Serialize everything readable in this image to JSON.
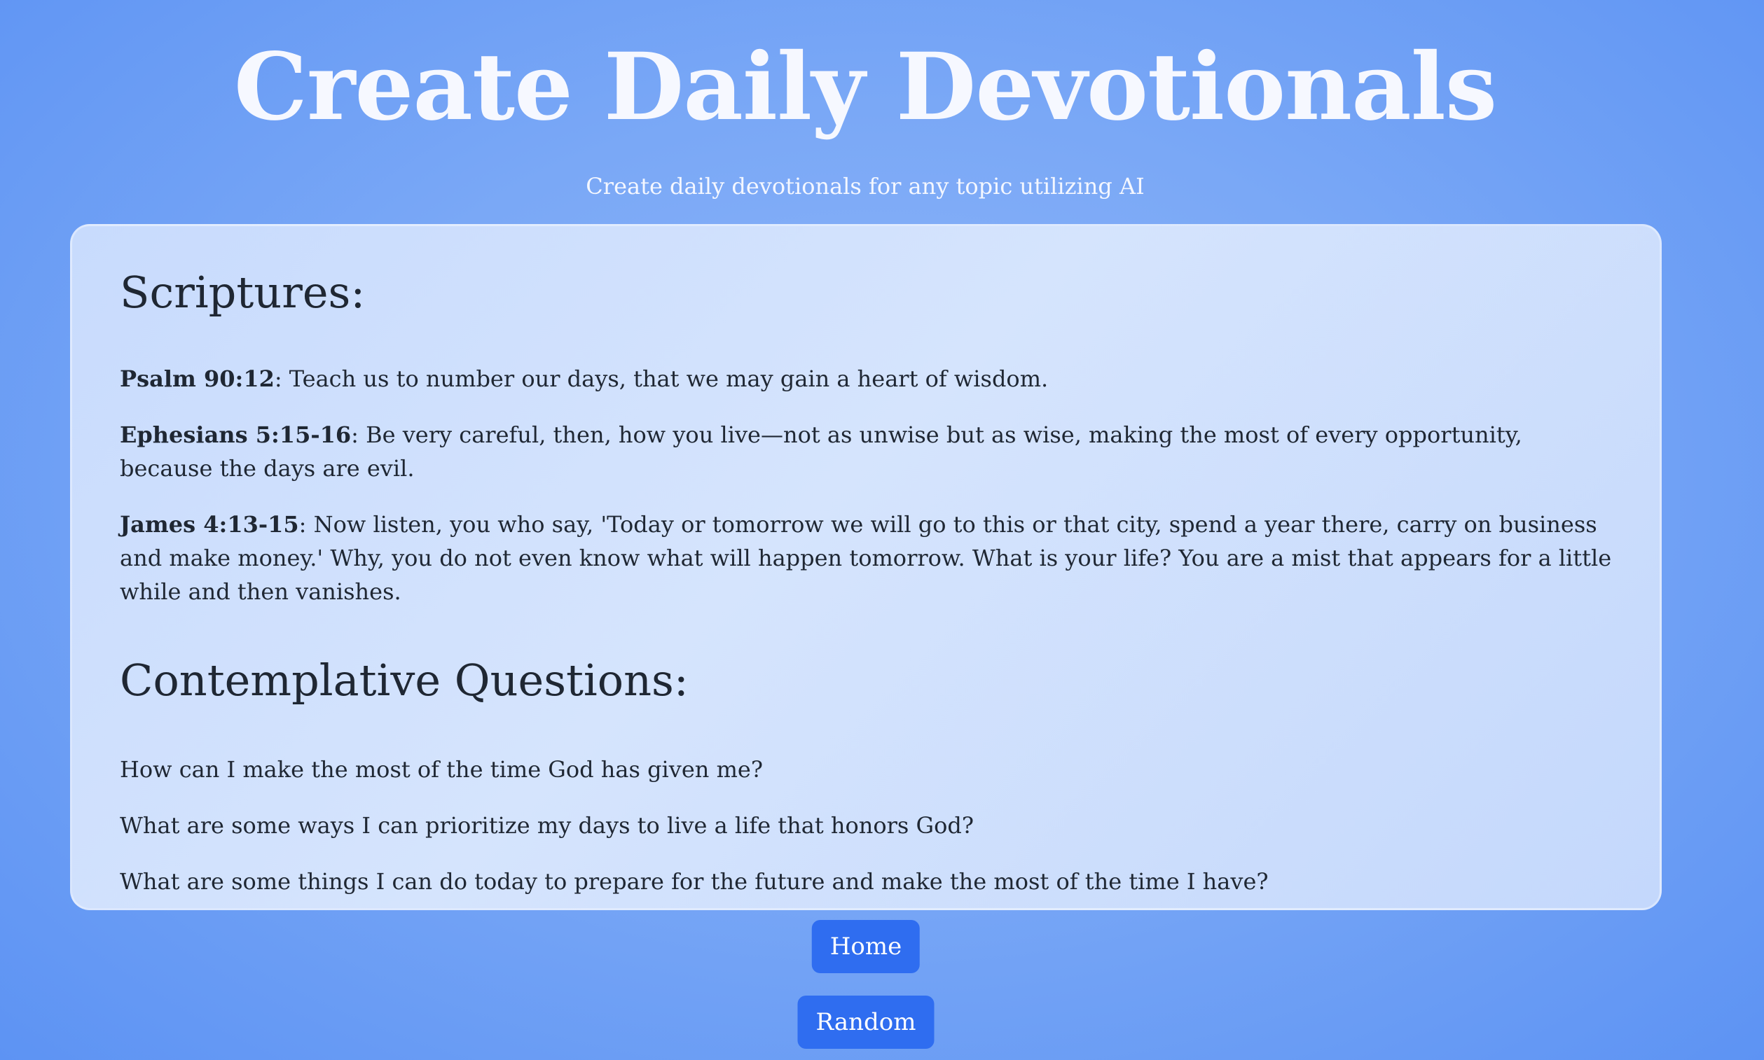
{
  "header": {
    "title": "Create Daily Devotionals",
    "subtitle": "Create daily devotionals for any topic utilizing AI"
  },
  "scriptures": {
    "heading": "Scriptures:",
    "items": [
      {
        "reference": "Psalm 90:12",
        "text": ": Teach us to number our days, that we may gain a heart of wisdom."
      },
      {
        "reference": "Ephesians 5:15-16",
        "text": ": Be very careful, then, how you live—not as unwise but as wise, making the most of every opportunity, because the days are evil."
      },
      {
        "reference": "James 4:13-15",
        "text": ": Now listen, you who say, 'Today or tomorrow we will go to this or that city, spend a year there, carry on business and make money.' Why, you do not even know what will happen tomorrow. What is your life? You are a mist that appears for a little while and then vanishes."
      }
    ]
  },
  "questions": {
    "heading": "Contemplative Questions:",
    "items": [
      "How can I make the most of the time God has given me?",
      "What are some ways I can prioritize my days to live a life that honors God?",
      "What are some things I can do today to prepare for the future and make the most of the time I have?"
    ]
  },
  "buttons": {
    "home_label": "Home",
    "random_label": "Random"
  },
  "colors": {
    "background": "#7aa8f6",
    "card": "#d0e1fd",
    "button": "#2f6df0",
    "title_text": "#f6f8ff",
    "body_text": "#1f2733"
  }
}
